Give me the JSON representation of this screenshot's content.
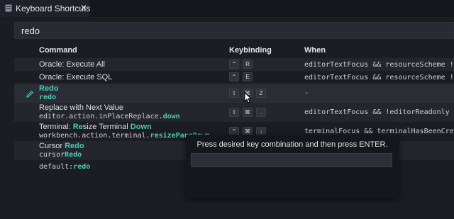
{
  "tab": {
    "title": "Keyboard Shortcuts",
    "close": "✕"
  },
  "search": {
    "value": "redo"
  },
  "columns": {
    "command": "Command",
    "keybinding": "Keybinding",
    "when": "When"
  },
  "rows": [
    {
      "cmd": "Oracle: Execute All",
      "keys": [
        "⌃",
        "R"
      ],
      "when": "editorTextFocus && resourceScheme != 'oracle'"
    },
    {
      "cmd": "Oracle: Execute SQL",
      "keys": [
        "⌃",
        "E"
      ],
      "when": "editorTextFocus && resourceScheme != 'oracle'"
    },
    {
      "cmd_hl": "Redo",
      "id_hl": "redo",
      "keys": [
        "⇧",
        "⌘",
        "Z"
      ],
      "when": "-"
    },
    {
      "cmd": "Replace with Next Value",
      "id_pre": "editor.action.inPlaceReplace.",
      "id_hl": "down",
      "keys": [
        "⇧",
        "⌘",
        "."
      ],
      "when": "editorTextFocus && !editorReadonly"
    },
    {
      "cmd_pre": "Terminal: ",
      "cmd_hl1": "Re",
      "cmd_mid": "size Terminal ",
      "cmd_hl2": "Down",
      "id_pre": "workbench.action.terminal.",
      "id_hl1": "resizePaneDo",
      "id_post": "wn",
      "keys": [
        "⌃",
        "⌘",
        "↓"
      ],
      "when": "terminalFocus && terminalHasBeenCreated || terminalProcessSupported"
    },
    {
      "cmd_pre": "Cursor ",
      "cmd_hl": "Redo",
      "id_pre": "cursor",
      "id_hl": "Redo"
    },
    {
      "id_pre": "default:",
      "id_hl": "redo"
    }
  ],
  "overlay": {
    "message": "Press desired key combination and then press ENTER."
  }
}
